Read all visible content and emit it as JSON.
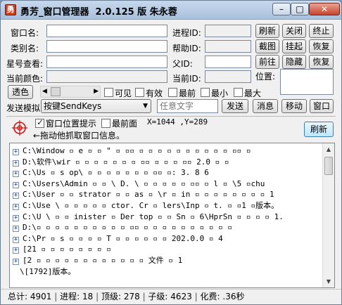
{
  "window": {
    "title": "勇芳_窗口管理器  2.0.125 版 朱永蓉",
    "icon_glyph": "勇",
    "min_glyph": "–",
    "max_glyph": "□",
    "close_glyph": "✕"
  },
  "fields": {
    "window_name_label": "窗口名:",
    "class_name_label": "类别名:",
    "star_view_label": "星号查看:",
    "current_color_label": "当前颜色:",
    "process_id_label": "进程ID:",
    "help_id_label": "帮助ID:",
    "parent_id_label": "父ID:",
    "current_id_label": "当前ID:",
    "position_label": "位置:",
    "arbitrary_text_placeholder": "任意文字"
  },
  "buttons": {
    "refresh": "刷新",
    "close": "关闭",
    "terminate": "终止",
    "screenshot": "截图",
    "suspend": "挂起",
    "restore1": "恢复",
    "goto": "前往",
    "hide": "隐藏",
    "restore2": "恢复",
    "transparent": "透色",
    "send": "发送",
    "message": "消息",
    "move": "移动",
    "window": "窗口",
    "refresh_list": "刷新"
  },
  "checkboxes": {
    "visible": "可见",
    "enabled": "有效",
    "topmost": "最前",
    "minimize": "最小",
    "maximize": "最大",
    "position_hint": "窗口位置提示",
    "front": "最前面"
  },
  "send_mode": {
    "label": "发送模拟",
    "selected": "按键SendKeys"
  },
  "drag_hint": "←拖动他抓取窗口信息。",
  "coords": "X=1044 ,Y=289",
  "tree_rows": [
    "C:\\Window  ▫   e   ▫  ▫  \"  ▫ ▫▫ ▫ ▫ ▫  ▫ ▫ ▫  ▫ ▫ ▫  ▫  ▫▫ ▫",
    "D:\\软件\\wir   ▫  ▫  ▫ ▫ ▫ ▫  ▫ ▫▫ ▫ ▫ ▫ ▫▫ 2.0 ▫  ▫",
    "C:\\Us       ▫   s   op\\ ▫ ▫  ▫   ▫  ▫  ▫ ▫ ▫▫ ▫: 3.   8   6",
    "C:\\Users\\Admin  ▫ ▫ \\  D. \\  ▫   ▫  ▫  ▫ ▫ ▫▫ ▫  l  ▫ \\5 ▫chu",
    "C:\\User  ▫ ▫ strator  ▫ ▫ as ▫ \\r ▫ in ▫ ▫  ▫ ▫  ▫ ▫ ▫ ▫  1",
    "C:\\Use  \\  ▫ ▫ ▫ ▫  ▫  ctor. Cr ▫ lers\\Inp ▫ t. ▫ ▫1 ▫版本。",
    "C:\\U  \\ ▫ ▫ inister  ▫ Der  top ▫ ▫ Sn ▫ 6\\HprSn ▫ ▫  ▫ ▫ 1.",
    "D:\\▫ ▫ ▫ ▫ ▫  ▫  ▫ ▫  ▫  ▫  ▫▫ ▫ ▫  ▫ ▫  ▫ ▫ ▫ ▫ ▫ ▫",
    "C:\\Pr   ▫    s  ▫ ▫  ▫ ▫  T  ▫  ▫  ▫ ▫  ▫ ▫ 202.0.0 ▫ 4",
    "[21 ▫  ▫ ▫ ▫ ▫  ▫  ▫ ▫",
    "[2 ▫ ▫  ▫ ▫ ▫ ▫ ▫ ▫ ▫  ▫ ▫ ▫ 文件 ▫ 1",
    "\\[1792]版本。"
  ],
  "status": {
    "total_label": "总计:",
    "total": "4901",
    "process_label": "进程:",
    "process": "18",
    "top_label": "顶级:",
    "top": "278",
    "child_label": "子级:",
    "child": "4623",
    "cost_label": "化费:",
    "cost": ".36秒"
  }
}
